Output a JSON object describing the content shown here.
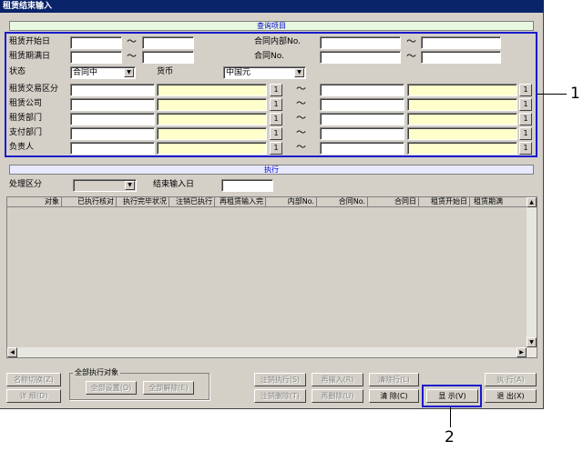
{
  "window": {
    "title": "租赁结束输入"
  },
  "query": {
    "section_title": "查询项目",
    "tilde": "～",
    "start_date_label": "租赁开始日",
    "end_date_label": "租赁期满日",
    "contract_internal_label": "合同内部No.",
    "contract_no_label": "合同No.",
    "status_label": "状态",
    "status_value": "合同中",
    "currency_label": "货币",
    "currency_value": "中国元",
    "rows": [
      {
        "label": "租赁交易区分"
      },
      {
        "label": "租赁公司"
      },
      {
        "label": "租赁部门"
      },
      {
        "label": "支付部门"
      },
      {
        "label": "负责人"
      }
    ],
    "search_btn": "1"
  },
  "exec": {
    "section_title": "执行",
    "process_label": "处理区分",
    "end_input_date_label": "结束输入日"
  },
  "grid": {
    "columns": [
      "对象",
      "已执行核对",
      "执行完毕状况",
      "注销已执行",
      "再租赁输入完",
      "内部No.",
      "合同No.",
      "合同日",
      "租赁开始日",
      "租赁期满"
    ]
  },
  "buttons": {
    "switch_name": "名称切换(Z)",
    "detail": "详 细(D)",
    "group_title": "全部执行对象",
    "set_all": "全部设置(O)",
    "clear_all": "全部解除(E)",
    "cancel_exec": "注销执行(S)",
    "cancel_delete": "注销删除(T)",
    "re_input": "再输入(R)",
    "re_delete": "再删除(U)",
    "clear_row": "清除行(L)",
    "clear": "清 除(C)",
    "display": "显 示(V)",
    "execute": "执 行(A)",
    "exit": "退 出(X)"
  },
  "callouts": {
    "one": "1",
    "two": "2"
  },
  "colors": {
    "highlight": "#1a1acc",
    "title_bar": "#0a246a",
    "yellow_field": "#ffffcc"
  }
}
